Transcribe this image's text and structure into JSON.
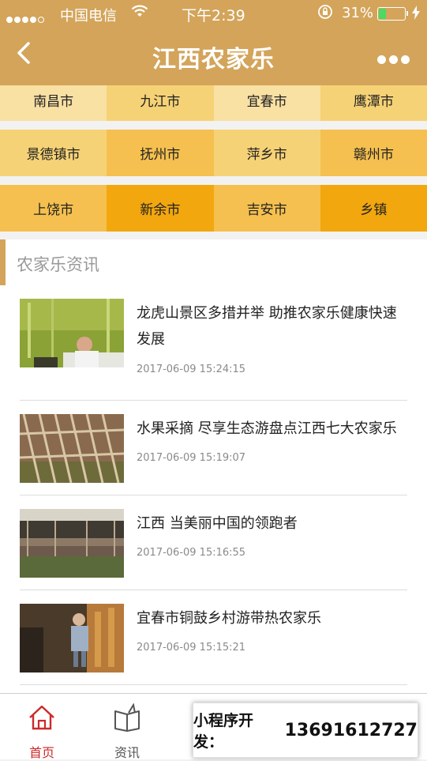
{
  "status_bar": {
    "carrier": "中国电信",
    "time": "下午2:39",
    "battery": "31%",
    "battery_level": 0.31
  },
  "nav": {
    "title": "江西农家乐"
  },
  "cities": [
    {
      "name": "南昌市",
      "color": "#f9e0a3"
    },
    {
      "name": "九江市",
      "color": "#f6d276"
    },
    {
      "name": "宜春市",
      "color": "#f9e0a3"
    },
    {
      "name": "鹰潭市",
      "color": "#f6d276"
    },
    {
      "name": "景德镇市",
      "color": "#f6d276"
    },
    {
      "name": "抚州市",
      "color": "#f5c04f"
    },
    {
      "name": "萍乡市",
      "color": "#f6d276"
    },
    {
      "name": "赣州市",
      "color": "#f5c04f"
    },
    {
      "name": "上饶市",
      "color": "#f5c04f"
    },
    {
      "name": "新余市",
      "color": "#f2a70e"
    },
    {
      "name": "吉安市",
      "color": "#f5c04f"
    },
    {
      "name": "乡镇",
      "color": "#f2a70e"
    }
  ],
  "news": {
    "section_title": "农家乐资讯",
    "items": [
      {
        "title": "龙虎山景区多措并举 助推农家乐健康快速发展",
        "date": "2017-06-09 15:24:15"
      },
      {
        "title": "水果采摘 尽享生态游盘点江西七大农家乐",
        "date": "2017-06-09 15:19:07"
      },
      {
        "title": "江西 当美丽中国的领跑者",
        "date": "2017-06-09 15:16:55"
      },
      {
        "title": "宜春市铜鼓乡村游带热农家乐",
        "date": "2017-06-09 15:15:21"
      }
    ]
  },
  "tabs": [
    {
      "label": "首页",
      "icon": "home-icon",
      "active": true
    },
    {
      "label": "资讯",
      "icon": "book-icon",
      "active": false
    }
  ],
  "promo": {
    "label": "小程序开发：",
    "phone": "13691612727"
  },
  "colors": {
    "brand": "#d3a45a",
    "active_tab": "#cc2a2a"
  }
}
